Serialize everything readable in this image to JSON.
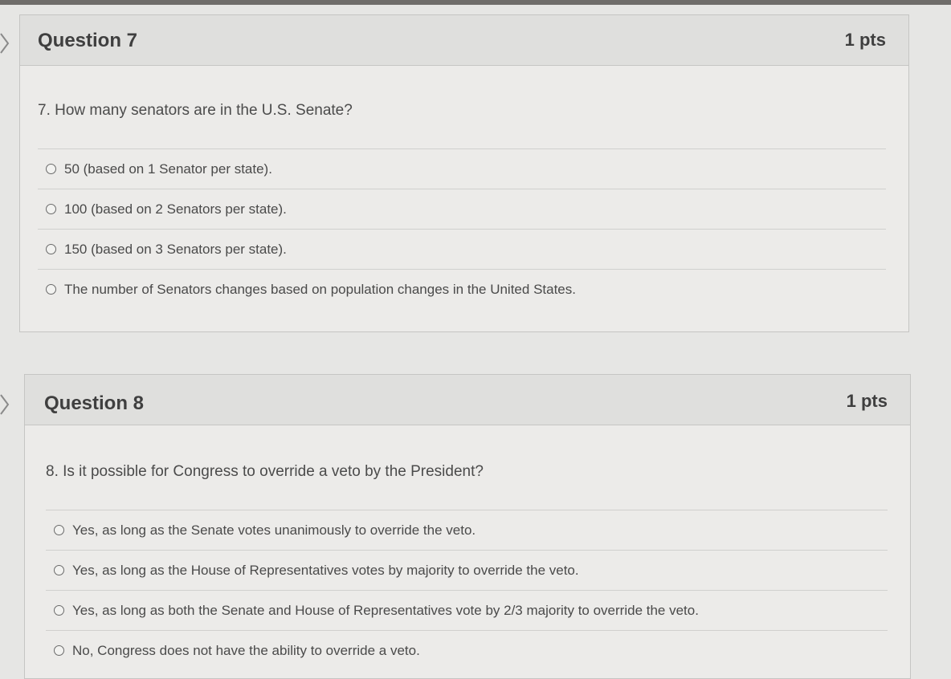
{
  "questions": [
    {
      "title": "Question 7",
      "points": "1 pts",
      "prompt": "7.  How many senators are in the U.S. Senate?",
      "answers": [
        "50 (based on 1 Senator per state).",
        "100 (based on 2 Senators per state).",
        "150 (based on 3 Senators per state).",
        "The number of Senators changes based on population changes in the United States."
      ]
    },
    {
      "title": "Question 8",
      "points": "1 pts",
      "prompt": "8.  Is it possible for Congress to override a veto by the President?",
      "answers": [
        "Yes, as long as the Senate votes unanimously to override the veto.",
        "Yes, as long as the House of Representatives votes by majority to override the veto.",
        "Yes, as long as both the Senate and House of Representatives vote by 2/3 majority to override the veto.",
        "No, Congress does not have the ability to override a veto."
      ]
    }
  ]
}
